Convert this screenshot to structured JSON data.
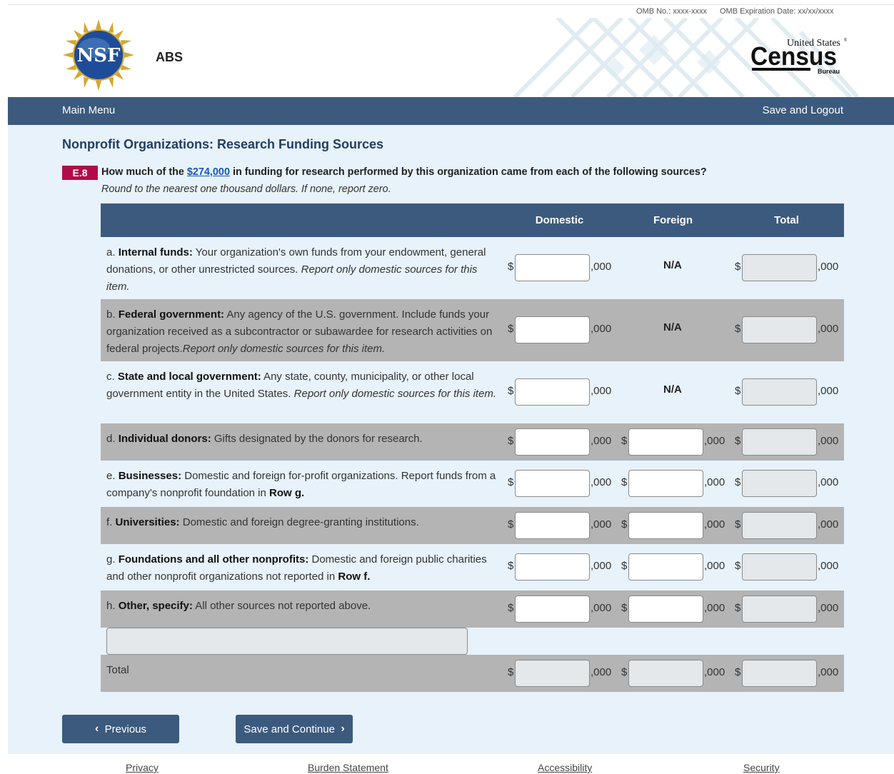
{
  "omb": {
    "number": "OMB No.: xxxx-xxxx",
    "expiration": "OMB Expiration Date: xx/xx/xxxx"
  },
  "header": {
    "app_name": "ABS",
    "nsf_logo_text": "NSF",
    "census_logo": {
      "line1": "United States",
      "line2": "Census",
      "line3": "Bureau"
    }
  },
  "nav": {
    "main_menu": "Main Menu",
    "save_logout": "Save and Logout"
  },
  "page": {
    "title": "Nonprofit Organizations: Research Funding Sources",
    "question_id": "E.8",
    "question_pre": "How much of the ",
    "question_link": "$274,000",
    "question_post": " in funding for research performed by this organization came from each of the following sources?",
    "question_note": "Round to the nearest one thousand dollars. If none, report zero."
  },
  "table": {
    "headers": {
      "domestic": "Domestic",
      "foreign": "Foreign",
      "total": "Total"
    },
    "currency": "$",
    "suffix": ",000",
    "na": "N/A",
    "rows": [
      {
        "prefix": "a. ",
        "bold": "Internal funds:",
        "text": " Your organization's own funds from your endowment, general donations, or other unrestricted sources. ",
        "italic": "Report only domestic sources for this item.",
        "row_ref": ""
      },
      {
        "prefix": "b. ",
        "bold": "Federal government:",
        "text": " Any agency of the U.S. government. Include funds your organization received as a subcontractor or subawardee for research activities on federal projects.",
        "italic": "Report only domestic sources for this item.",
        "row_ref": ""
      },
      {
        "prefix": "c. ",
        "bold": "State and local government:",
        "text": " Any state, county, municipality, or other local government entity in the United States. ",
        "italic": "Report only domestic sources for this item.",
        "row_ref": ""
      },
      {
        "prefix": "d. ",
        "bold": "Individual donors:",
        "text": " Gifts designated by the donors for research.",
        "italic": "",
        "row_ref": ""
      },
      {
        "prefix": "e. ",
        "bold": "Businesses:",
        "text": " Domestic and foreign for-profit organizations. Report funds from a company's nonprofit foundation in ",
        "italic": "",
        "row_ref": "Row g."
      },
      {
        "prefix": "f. ",
        "bold": "Universities:",
        "text": " Domestic and foreign degree-granting institutions.",
        "italic": "",
        "row_ref": ""
      },
      {
        "prefix": "g. ",
        "bold": "Foundations and all other nonprofits:",
        "text": " Domestic and foreign public charities and other nonprofit organizations not reported in ",
        "italic": "",
        "row_ref": "Row f."
      },
      {
        "prefix": "h. ",
        "bold": "Other, specify:",
        "text": " All other sources not reported above.",
        "italic": "",
        "row_ref": ""
      }
    ],
    "total_label": "Total"
  },
  "buttons": {
    "previous": "Previous",
    "save_continue": "Save and Continue"
  },
  "footer": {
    "privacy": "Privacy",
    "burden": "Burden Statement",
    "accessibility": "Accessibility",
    "security": "Security"
  },
  "colors": {
    "navy": "#3c5a7d",
    "badge": "#b20b49",
    "panel": "#e8f2fa",
    "alt_row": "#b4b4b4",
    "link": "#1458b8"
  }
}
